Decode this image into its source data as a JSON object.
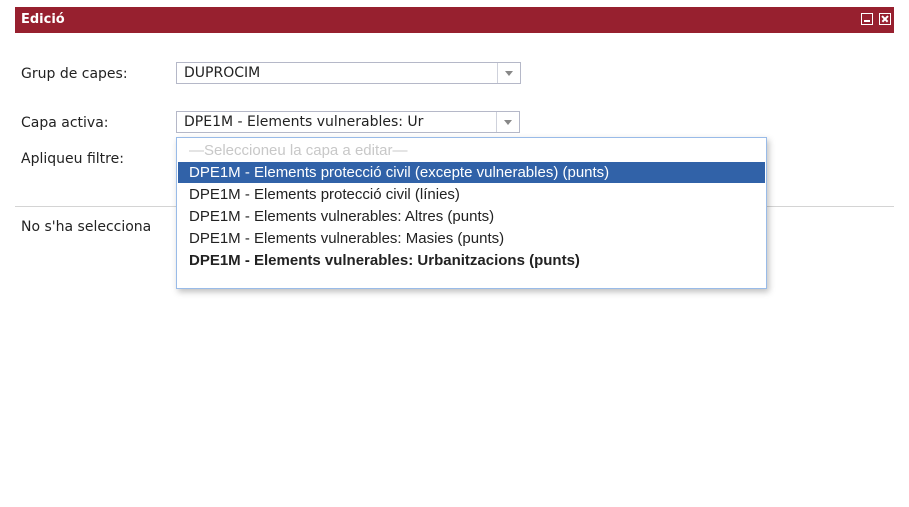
{
  "window": {
    "title": "Edició",
    "minimize_icon": "minimize-icon",
    "close_icon": "close-icon",
    "titlebar_color": "#97202f"
  },
  "form": {
    "group_label": "Grup de capes:",
    "group_value": "DUPROCIM",
    "layer_label": "Capa activa:",
    "layer_value": "DPE1M - Elements vulnerables: Ur",
    "filter_label": "Apliqueu filtre:",
    "status_text": "No s'ha selecciona"
  },
  "dropdown": {
    "placeholder": "—Seleccioneu la capa a editar—",
    "options": [
      "DPE1M - Elements protecció civil (excepte vulnerables) (punts)",
      "DPE1M - Elements protecció civil (línies)",
      "DPE1M - Elements vulnerables: Altres (punts)",
      "DPE1M - Elements vulnerables: Masies (punts)",
      "DPE1M - Elements vulnerables: Urbanitzacions (punts)"
    ],
    "highlighted_index": 0,
    "current_index": 4,
    "highlight_color": "#3162a8"
  }
}
